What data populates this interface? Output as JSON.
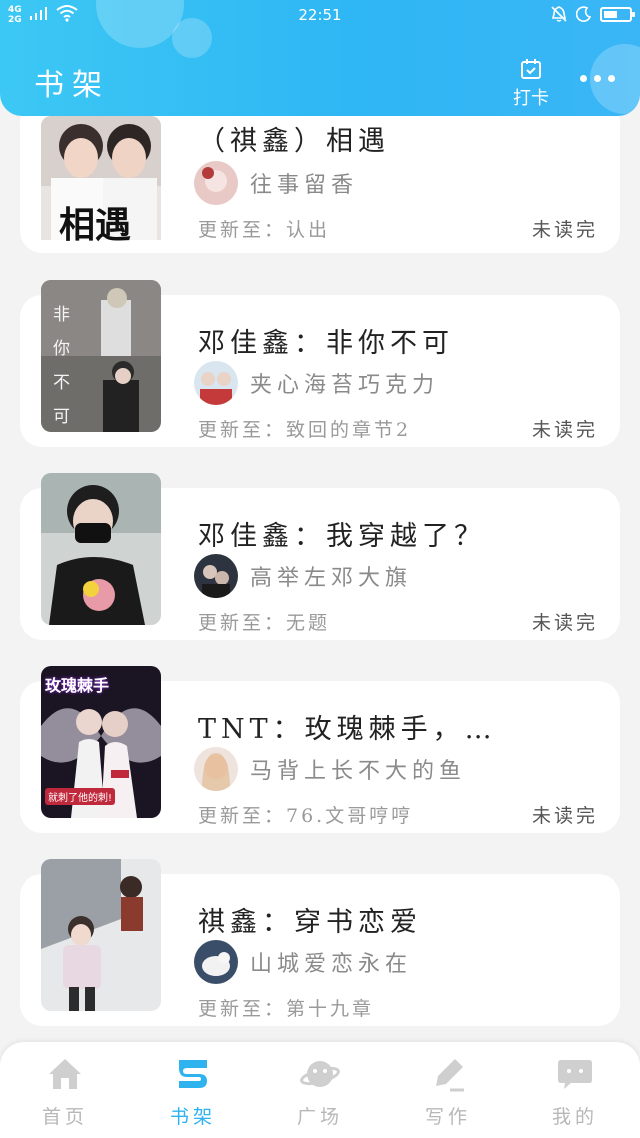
{
  "status_bar": {
    "network_top": "4G",
    "network_bottom": "2G",
    "time": "22:51",
    "battery_percent": 55
  },
  "header": {
    "title": "书架",
    "checkin_label": "打卡"
  },
  "books": [
    {
      "title": "（祺鑫）相遇",
      "author": "往事留香",
      "update": "更新至：认出",
      "status": "未读完",
      "cover_text": "相遇"
    },
    {
      "title": "邓佳鑫：非你不可",
      "author": "夹心海苔巧克力",
      "update": "更新至：致回的章节2",
      "status": "未读完",
      "cover_text": "非你不可"
    },
    {
      "title": "邓佳鑫：我穿越了？",
      "author": "高举左邓大旗",
      "update": "更新至：无题",
      "status": "未读完",
      "cover_text": ""
    },
    {
      "title": "TNT：玫瑰棘手，…",
      "author": "马背上长不大的鱼",
      "update": "更新至：76.文哥哼哼",
      "status": "未读完",
      "cover_text": "玫瑰棘手",
      "cover_caption": "就刺了他的刺!"
    },
    {
      "title": "祺鑫：穿书恋爱",
      "author": "山城爱恋永在",
      "update": "更新至：第十九章",
      "status": "",
      "cover_text": ""
    }
  ],
  "bottom_nav": [
    {
      "label": "首页",
      "icon": "home-icon",
      "active": false
    },
    {
      "label": "书架",
      "icon": "bookshelf-icon",
      "active": true
    },
    {
      "label": "广场",
      "icon": "planet-icon",
      "active": false
    },
    {
      "label": "写作",
      "icon": "pencil-icon",
      "active": false
    },
    {
      "label": "我的",
      "icon": "chat-bubble-icon",
      "active": false
    }
  ],
  "colors": {
    "accent": "#2eb3ef",
    "header_start": "#3cc8f4",
    "header_end": "#2fb6f4",
    "inactive": "#b8b8b8"
  }
}
